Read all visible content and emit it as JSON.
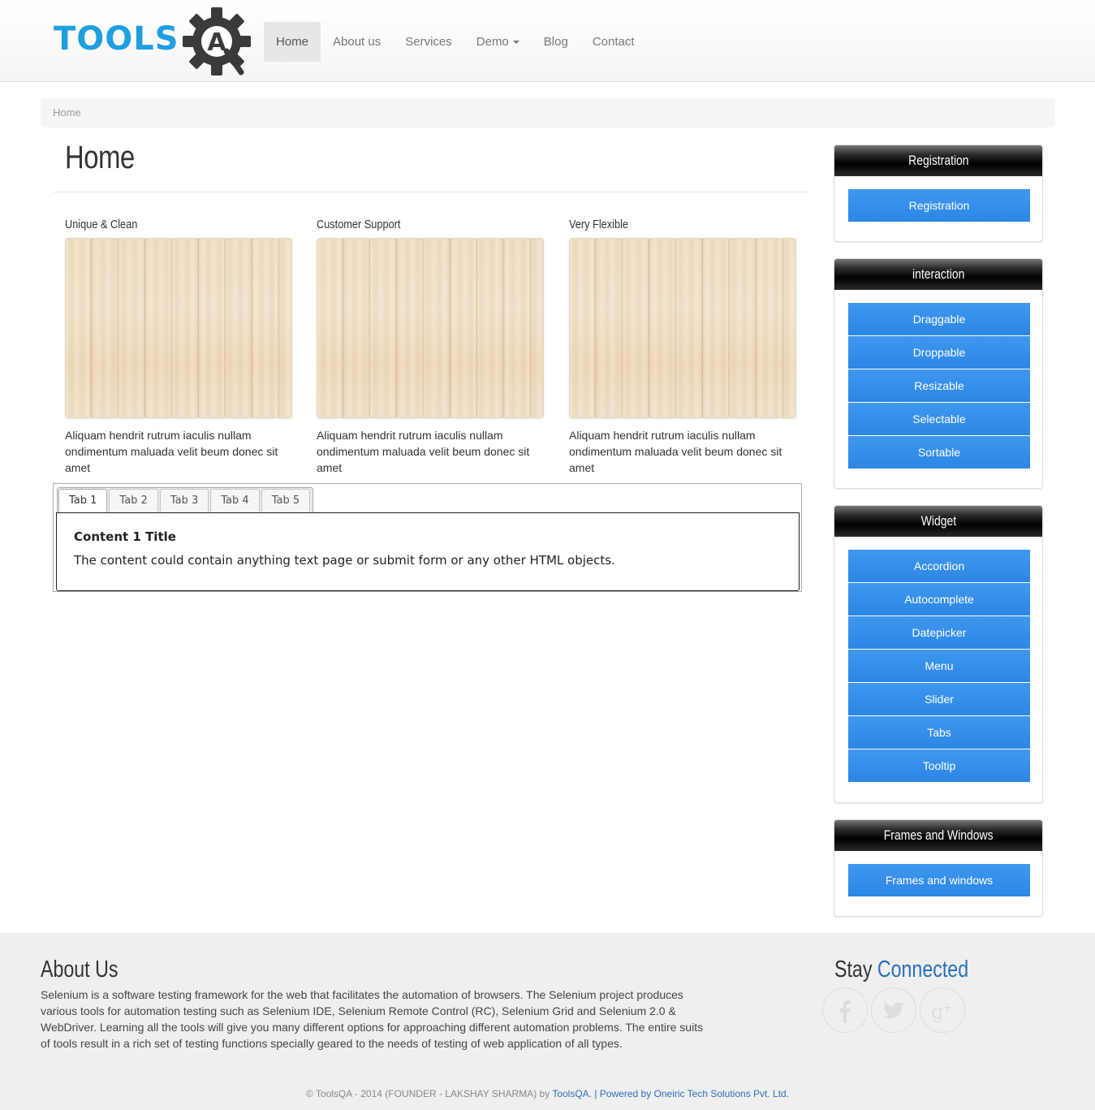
{
  "logo": {
    "text": "TOOLS",
    "mark": "A"
  },
  "nav": {
    "items": [
      "Home",
      "About us",
      "Services",
      "Demo",
      "Blog",
      "Contact"
    ]
  },
  "breadcrumb": {
    "current": "Home"
  },
  "page": {
    "title": "Home"
  },
  "features": [
    {
      "title": "Unique & Clean",
      "text": "Aliquam hendrit rutrum iaculis nullam ondimentum maluada velit beum donec sit amet"
    },
    {
      "title": "Customer Support",
      "text": "Aliquam hendrit rutrum iaculis nullam ondimentum maluada velit beum donec sit amet"
    },
    {
      "title": "Very Flexible",
      "text": "Aliquam hendrit rutrum iaculis nullam ondimentum maluada velit beum donec sit amet"
    }
  ],
  "tabs": {
    "labels": [
      "Tab 1",
      "Tab 2",
      "Tab 3",
      "Tab 4",
      "Tab 5"
    ],
    "active_index": 0,
    "content_title": "Content 1 Title",
    "content_text": "The content could contain anything text page or submit form or any other HTML objects."
  },
  "sidebar": {
    "registration": {
      "title": "Registration",
      "buttons": [
        "Registration"
      ]
    },
    "interaction": {
      "title": "interaction",
      "buttons": [
        "Draggable",
        "Droppable",
        "Resizable",
        "Selectable",
        "Sortable"
      ]
    },
    "widget": {
      "title": "Widget",
      "buttons": [
        "Accordion",
        "Autocomplete",
        "Datepicker",
        "Menu",
        "Slider",
        "Tabs",
        "Tooltip"
      ]
    },
    "frames": {
      "title": "Frames and Windows",
      "buttons": [
        "Frames and windows"
      ]
    }
  },
  "footer": {
    "about_title": "About Us",
    "about_text": "Selenium is a software testing framework for the web that facilitates the automation of browsers. The Selenium project produces various tools for automation testing such as Selenium IDE, Selenium Remote Control (RC), Selenium Grid and Selenium 2.0 & WebDriver. Learning all the tools will give you many different options for approaching different automation problems. The entire suits of tools result in a rich set of testing functions specially geared to the needs of testing of web application of all types.",
    "stay_word": "Stay",
    "connected_word": "Connected",
    "social_icons": [
      "facebook-icon",
      "twitter-icon",
      "google-plus-icon"
    ],
    "copyright_prefix": "© ToolsQA - 2014 (FOUNDER - LAKSHAY SHARMA) by",
    "copyright_link": "ToolsQA",
    "copyright_sep": ". |",
    "powered_by": "Powered by Oneiric Tech Solutions Pvt. Ltd."
  },
  "colors": {
    "brand_blue": "#1e9fe0",
    "button_blue": "#2c86e4",
    "link_blue": "#2a6ebb",
    "widget_header": "#000000"
  }
}
